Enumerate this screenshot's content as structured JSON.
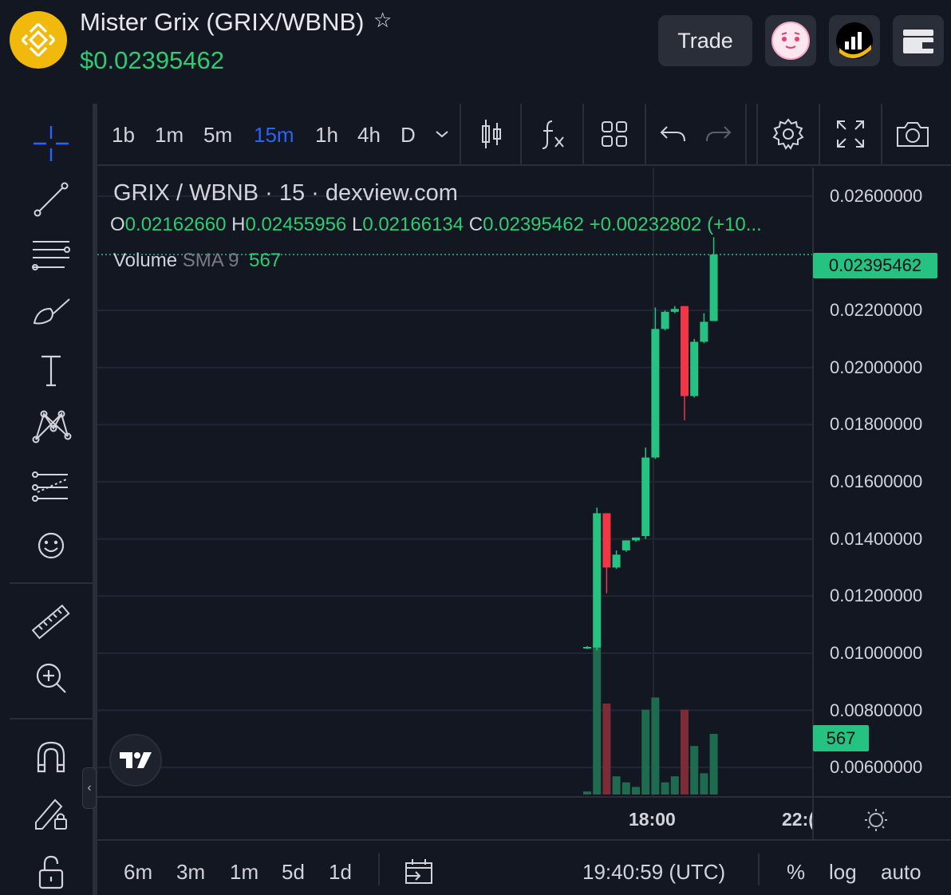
{
  "header": {
    "token_name": "Mister Grix (GRIX/WBNB)",
    "price": "$0.02395462",
    "trade_label": "Trade",
    "colors": {
      "accent_green": "#2ecc71",
      "bnb_yellow": "#f0b90b"
    }
  },
  "toolbar": {
    "intervals": [
      "1b",
      "1m",
      "5m",
      "15m",
      "1h",
      "4h",
      "D"
    ],
    "active_interval": "15m"
  },
  "legend": {
    "title": "GRIX / WBNB · 15 · dexview.com",
    "o_key": "O",
    "o_val": "0.02162660",
    "h_key": "H",
    "h_val": "0.02455956",
    "l_key": "L",
    "l_val": "0.02166134",
    "c_key": "C",
    "c_val": "0.02395462",
    "change": "+0.00232802 (+10...",
    "volume_label": "Volume",
    "sma_label": "SMA 9",
    "volume_value": "567"
  },
  "price_axis": {
    "labels": [
      "0.02600000",
      "0.02200000",
      "0.02000000",
      "0.01800000",
      "0.01600000",
      "0.01400000",
      "0.01200000",
      "0.01000000",
      "0.00800000",
      "0.00600000"
    ],
    "current_price_tag": "0.02395462",
    "volume_tag": "567"
  },
  "time_axis": {
    "labels": [
      "18:00",
      "22:("
    ]
  },
  "bottom_bar": {
    "ranges": [
      "6m",
      "3m",
      "1m",
      "5d",
      "1d"
    ],
    "clock": "19:40:59 (UTC)",
    "percent_label": "%",
    "log_label": "log",
    "auto_label": "auto"
  },
  "chart_data": {
    "type": "candlestick",
    "title": "GRIX / WBNB · 15 · dexview.com",
    "y_scale": {
      "min": 0.005,
      "max": 0.027
    },
    "y_ticks": [
      0.026,
      0.022,
      0.02,
      0.018,
      0.016,
      0.014,
      0.012,
      0.01,
      0.008,
      0.006
    ],
    "candles": [
      {
        "open": 0.0102,
        "high": 0.01025,
        "low": 0.01015,
        "close": 0.01022,
        "dir": "up"
      },
      {
        "open": 0.0102,
        "high": 0.0151,
        "low": 0.0101,
        "close": 0.0149,
        "dir": "up"
      },
      {
        "open": 0.0149,
        "high": 0.0149,
        "low": 0.0121,
        "close": 0.013,
        "dir": "down"
      },
      {
        "open": 0.013,
        "high": 0.0136,
        "low": 0.01295,
        "close": 0.01345,
        "dir": "up"
      },
      {
        "open": 0.0136,
        "high": 0.01395,
        "low": 0.01355,
        "close": 0.01395,
        "dir": "up"
      },
      {
        "open": 0.01395,
        "high": 0.01405,
        "low": 0.0139,
        "close": 0.01405,
        "dir": "up"
      },
      {
        "open": 0.0141,
        "high": 0.0172,
        "low": 0.014,
        "close": 0.01685,
        "dir": "up"
      },
      {
        "open": 0.01685,
        "high": 0.0221,
        "low": 0.0168,
        "close": 0.02135,
        "dir": "up"
      },
      {
        "open": 0.02135,
        "high": 0.022,
        "low": 0.0213,
        "close": 0.02195,
        "dir": "up"
      },
      {
        "open": 0.02195,
        "high": 0.02215,
        "low": 0.0219,
        "close": 0.02205,
        "dir": "up"
      },
      {
        "open": 0.02215,
        "high": 0.02215,
        "low": 0.01815,
        "close": 0.019,
        "dir": "down"
      },
      {
        "open": 0.019,
        "high": 0.021,
        "low": 0.01895,
        "close": 0.0209,
        "dir": "up"
      },
      {
        "open": 0.0209,
        "high": 0.0219,
        "low": 0.02085,
        "close": 0.0216,
        "dir": "up"
      },
      {
        "open": 0.0216266,
        "high": 0.02455956,
        "low": 0.02166134,
        "close": 0.02395462,
        "dir": "up"
      }
    ],
    "volumes": [
      2,
      100,
      60,
      12,
      8,
      5,
      56,
      64,
      8,
      12,
      56,
      32,
      14,
      40
    ],
    "volume_max": 100
  }
}
